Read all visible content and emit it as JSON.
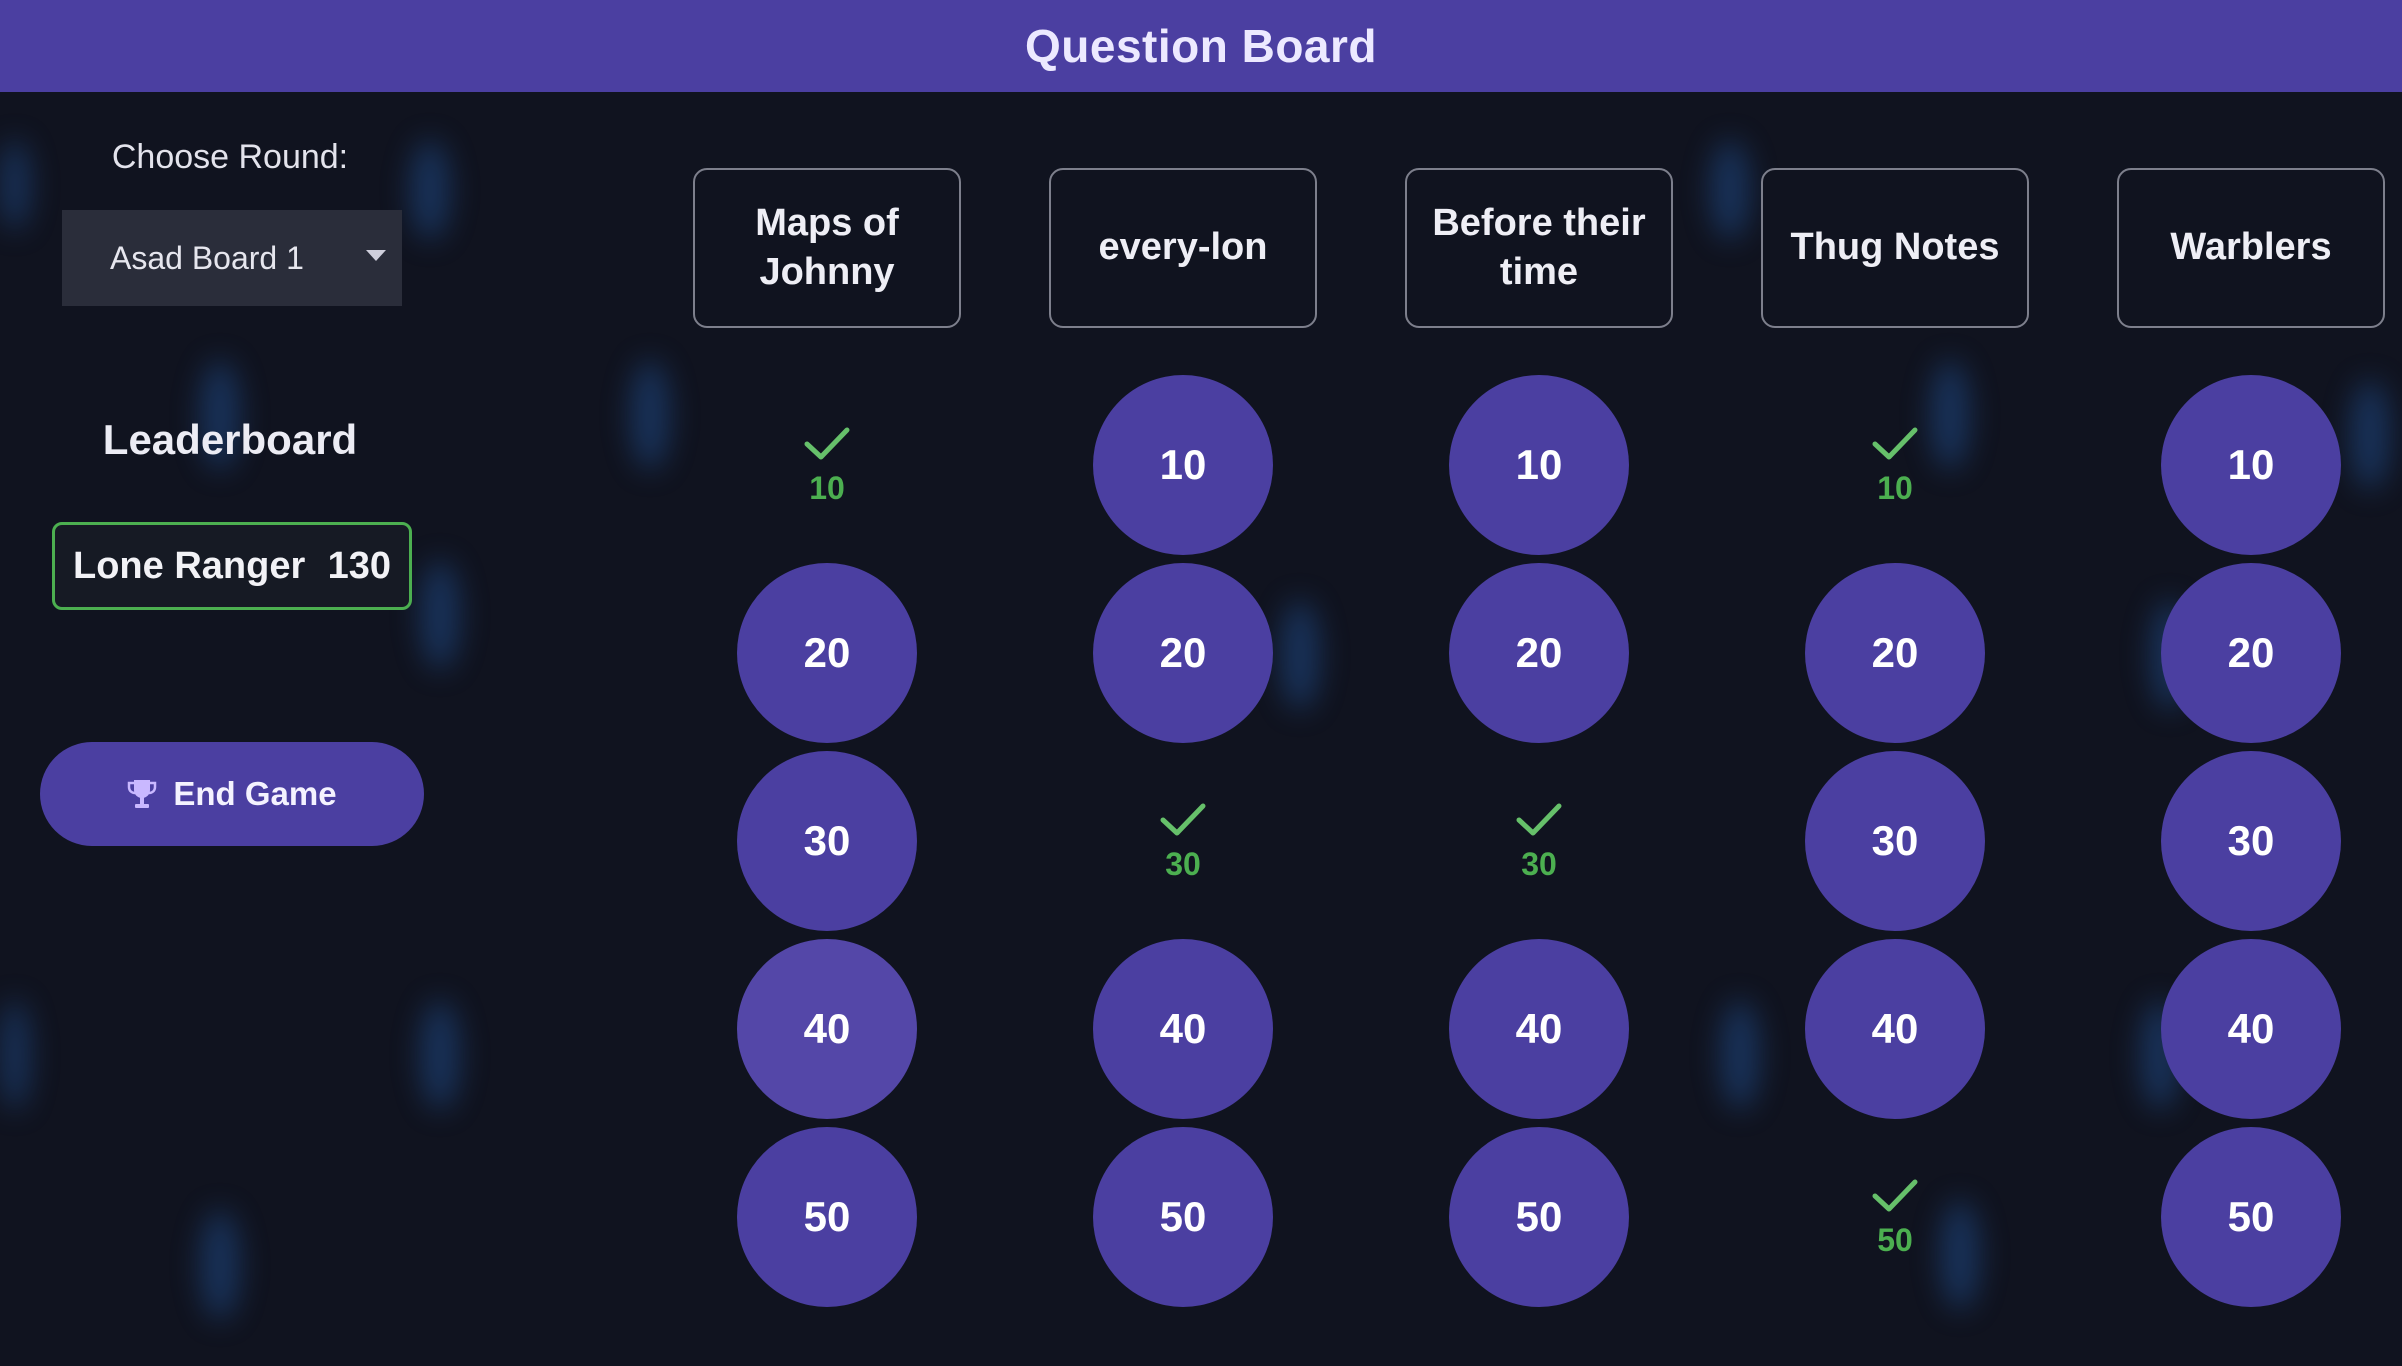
{
  "header": {
    "title": "Question Board"
  },
  "sidebar": {
    "round_label": "Choose Round:",
    "round_selected": "Asad Board 1",
    "leaderboard_title": "Leaderboard",
    "leaderboard": [
      {
        "name": "Lone Ranger",
        "score": "130"
      }
    ],
    "end_game_label": "End Game"
  },
  "board": {
    "categories": [
      {
        "title": "Maps of Johnny",
        "cells": [
          {
            "value": "10",
            "answered": true
          },
          {
            "value": "20",
            "answered": false
          },
          {
            "value": "30",
            "answered": false
          },
          {
            "value": "40",
            "answered": false,
            "hovered": true
          },
          {
            "value": "50",
            "answered": false
          }
        ]
      },
      {
        "title": "every-lon",
        "cells": [
          {
            "value": "10",
            "answered": false
          },
          {
            "value": "20",
            "answered": false
          },
          {
            "value": "30",
            "answered": true
          },
          {
            "value": "40",
            "answered": false
          },
          {
            "value": "50",
            "answered": false
          }
        ]
      },
      {
        "title": "Before their time",
        "cells": [
          {
            "value": "10",
            "answered": false
          },
          {
            "value": "20",
            "answered": false
          },
          {
            "value": "30",
            "answered": true
          },
          {
            "value": "40",
            "answered": false
          },
          {
            "value": "50",
            "answered": false
          }
        ]
      },
      {
        "title": "Thug Notes",
        "cells": [
          {
            "value": "10",
            "answered": true
          },
          {
            "value": "20",
            "answered": false
          },
          {
            "value": "30",
            "answered": false
          },
          {
            "value": "40",
            "answered": false
          },
          {
            "value": "50",
            "answered": true
          }
        ]
      },
      {
        "title": "Warblers",
        "cells": [
          {
            "value": "10",
            "answered": false
          },
          {
            "value": "20",
            "answered": false
          },
          {
            "value": "30",
            "answered": false
          },
          {
            "value": "40",
            "answered": false
          },
          {
            "value": "50",
            "answered": false
          }
        ]
      }
    ]
  },
  "colors": {
    "accent": "#4b3fa1",
    "background": "#10131f",
    "answered": "#4caf50"
  },
  "icons": {
    "end_game": "trophy-icon",
    "answered": "checkmark-icon",
    "round_dropdown": "chevron-down-icon"
  }
}
